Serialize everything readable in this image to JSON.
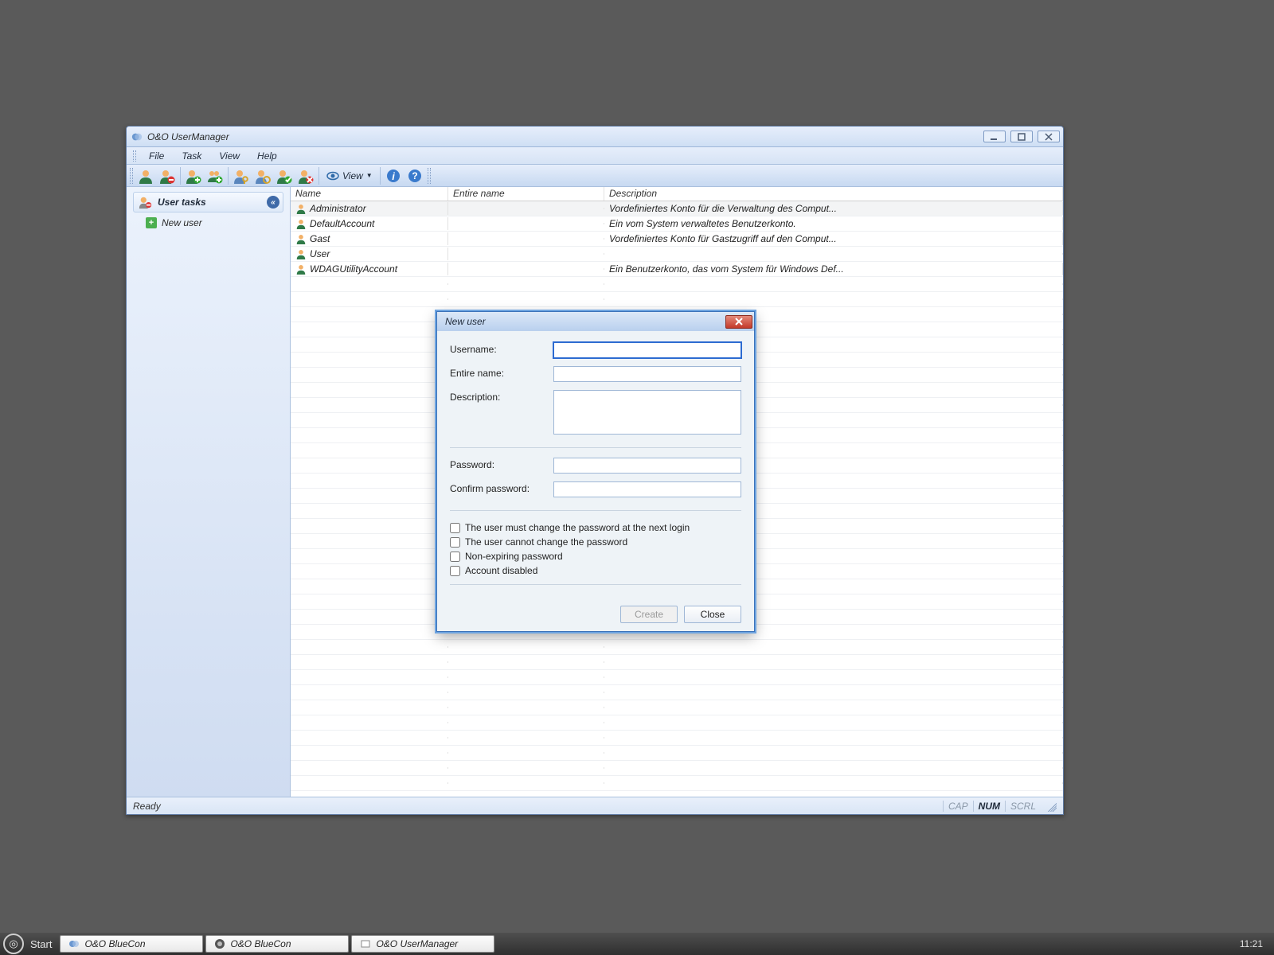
{
  "window": {
    "title": "O&O UserManager"
  },
  "menu": {
    "file": "File",
    "task": "Task",
    "view": "View",
    "help": "Help"
  },
  "toolbar": {
    "view_label": "View"
  },
  "sidebar": {
    "header": "User tasks",
    "new_user": "New user"
  },
  "table": {
    "columns": {
      "name": "Name",
      "entire": "Entire name",
      "desc": "Description"
    },
    "rows": [
      {
        "name": "Administrator",
        "entire": "",
        "desc": "Vordefiniertes Konto für die Verwaltung des Comput..."
      },
      {
        "name": "DefaultAccount",
        "entire": "",
        "desc": "Ein vom System verwaltetes Benutzerkonto."
      },
      {
        "name": "Gast",
        "entire": "",
        "desc": "Vordefiniertes Konto für Gastzugriff auf den Comput..."
      },
      {
        "name": "User",
        "entire": "",
        "desc": ""
      },
      {
        "name": "WDAGUtilityAccount",
        "entire": "",
        "desc": "Ein Benutzerkonto, das vom System für Windows Def..."
      }
    ]
  },
  "dialog": {
    "title": "New user",
    "labels": {
      "username": "Username:",
      "entire": "Entire name:",
      "desc": "Description:",
      "password": "Password:",
      "confirm": "Confirm password:"
    },
    "values": {
      "username": "",
      "entire": "",
      "desc": "",
      "password": "",
      "confirm": ""
    },
    "checks": {
      "must_change": "The user must change the password at the next login",
      "cannot_change": "The user cannot change the password",
      "non_expiring": "Non-expiring password",
      "disabled": "Account disabled"
    },
    "check_values": {
      "must_change": false,
      "cannot_change": false,
      "non_expiring": false,
      "disabled": false
    },
    "buttons": {
      "create": "Create",
      "close": "Close"
    }
  },
  "status": {
    "ready": "Ready",
    "cap": "CAP",
    "num": "NUM",
    "scrl": "SCRL"
  },
  "taskbar": {
    "start": "Start",
    "items": [
      {
        "label": "O&O BlueCon"
      },
      {
        "label": "O&O BlueCon"
      },
      {
        "label": "O&O UserManager"
      }
    ],
    "clock": "11:21"
  }
}
